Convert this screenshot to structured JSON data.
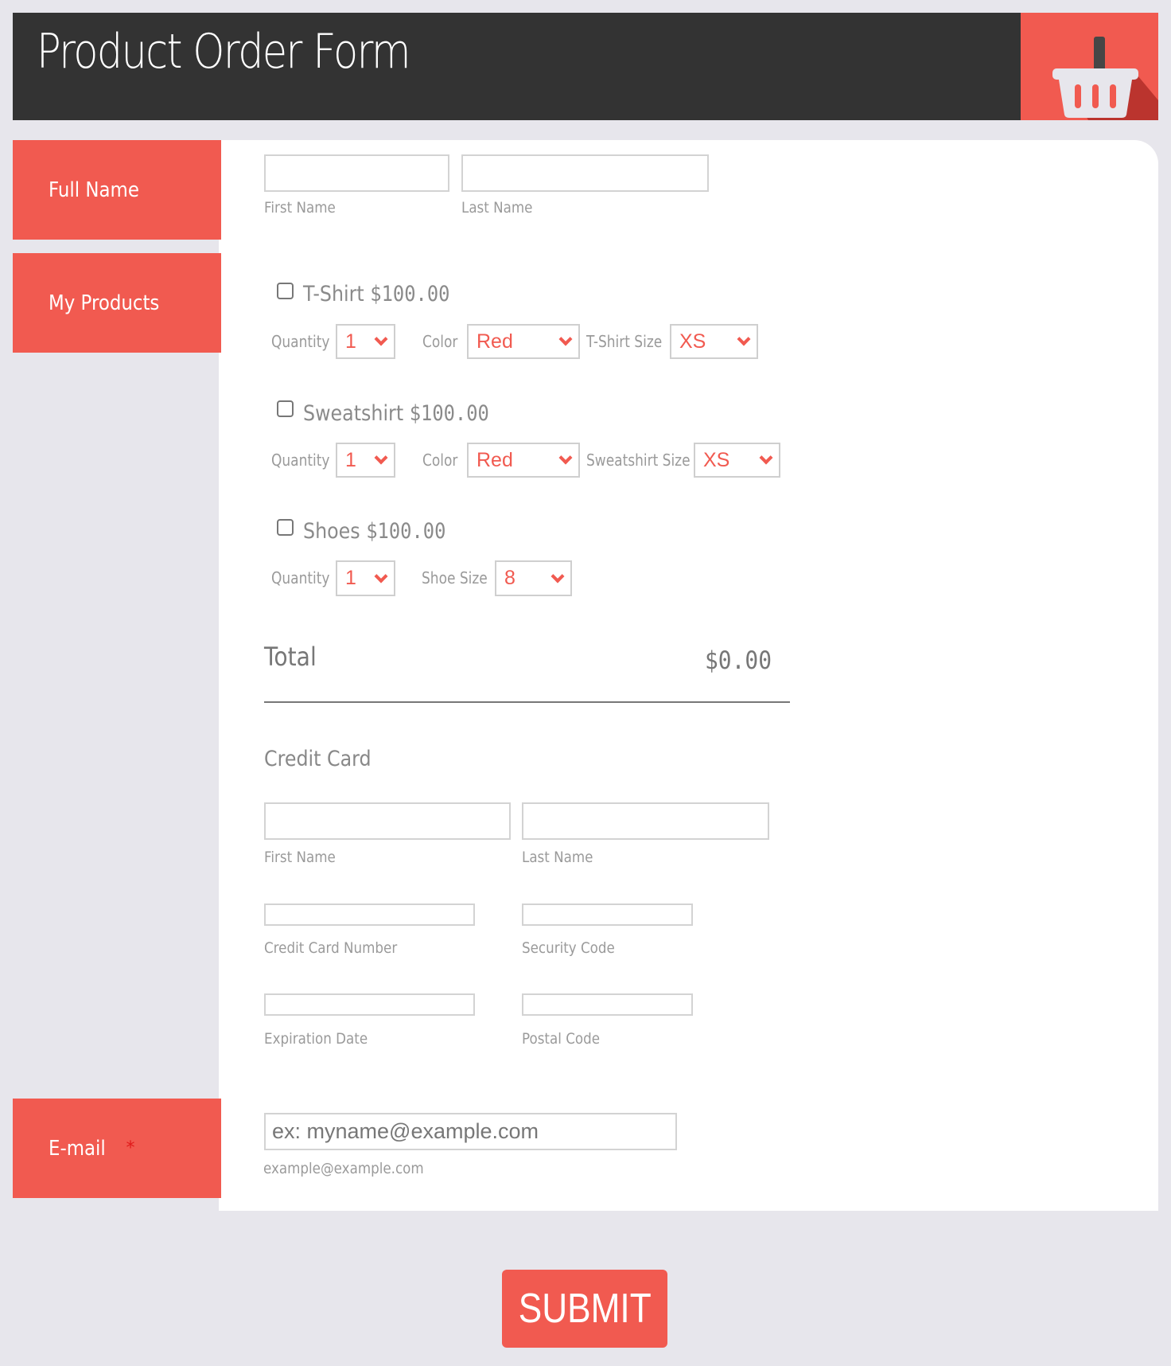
{
  "header": {
    "title": "Product Order Form",
    "icon": "shopping-basket-icon"
  },
  "colors": {
    "accent": "#f15a50",
    "header_bg": "#333333",
    "background": "#e7e6ec"
  },
  "sections": {
    "full_name": "Full Name",
    "my_products": "My Products",
    "email": "E-mail",
    "required_mark": "*"
  },
  "full_name": {
    "first_label": "First Name",
    "last_label": "Last Name",
    "first_value": "",
    "last_value": ""
  },
  "products": [
    {
      "name": "T-Shirt",
      "price": "$100.00",
      "checked": false,
      "quantity_label": "Quantity",
      "quantity": "1",
      "color_label": "Color",
      "color": "Red",
      "size_label": "T-Shirt Size",
      "size": "XS"
    },
    {
      "name": "Sweatshirt",
      "price": "$100.00",
      "checked": false,
      "quantity_label": "Quantity",
      "quantity": "1",
      "color_label": "Color",
      "color": "Red",
      "size_label": "Sweatshirt Size",
      "size": "XS"
    },
    {
      "name": "Shoes",
      "price": "$100.00",
      "checked": false,
      "quantity_label": "Quantity",
      "quantity": "1",
      "size_label": "Shoe Size",
      "size": "8"
    }
  ],
  "total": {
    "label": "Total",
    "value": "$0.00"
  },
  "credit_card": {
    "title": "Credit Card",
    "first_label": "First Name",
    "last_label": "Last Name",
    "number_label": "Credit Card Number",
    "security_label": "Security Code",
    "expiration_label": "Expiration Date",
    "postal_label": "Postal Code"
  },
  "email": {
    "placeholder": "ex: myname@example.com",
    "sublabel": "example@example.com"
  },
  "submit": {
    "label": "SUBMIT"
  }
}
